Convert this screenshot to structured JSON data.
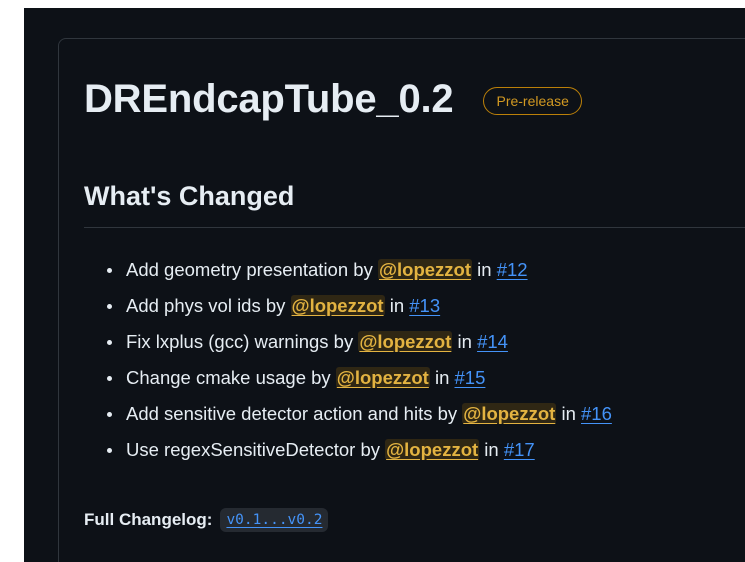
{
  "release": {
    "title": "DREndcapTube_0.2",
    "badge": "Pre-release"
  },
  "section": {
    "heading": "What's Changed"
  },
  "changes": [
    {
      "text": "Add geometry presentation by ",
      "author": "@lopezzot",
      "in": " in ",
      "pr": "#12"
    },
    {
      "text": "Add phys vol ids by ",
      "author": "@lopezzot",
      "in": " in ",
      "pr": "#13"
    },
    {
      "text": "Fix lxplus (gcc) warnings by ",
      "author": "@lopezzot",
      "in": " in ",
      "pr": "#14"
    },
    {
      "text": "Change cmake usage by ",
      "author": "@lopezzot",
      "in": " in ",
      "pr": "#15"
    },
    {
      "text": "Add sensitive detector action and hits by ",
      "author": "@lopezzot",
      "in": " in ",
      "pr": "#16"
    },
    {
      "text": "Use regexSensitiveDetector by ",
      "author": "@lopezzot",
      "in": " in ",
      "pr": "#17"
    }
  ],
  "changelog": {
    "label": "Full Changelog:",
    "compare": "v0.1...v0.2"
  },
  "colors": {
    "background": "#0d1117",
    "text": "#e6edf3",
    "link": "#4493f8",
    "mention": "#e3b341",
    "badge": "#d29922",
    "border": "#30363d"
  }
}
